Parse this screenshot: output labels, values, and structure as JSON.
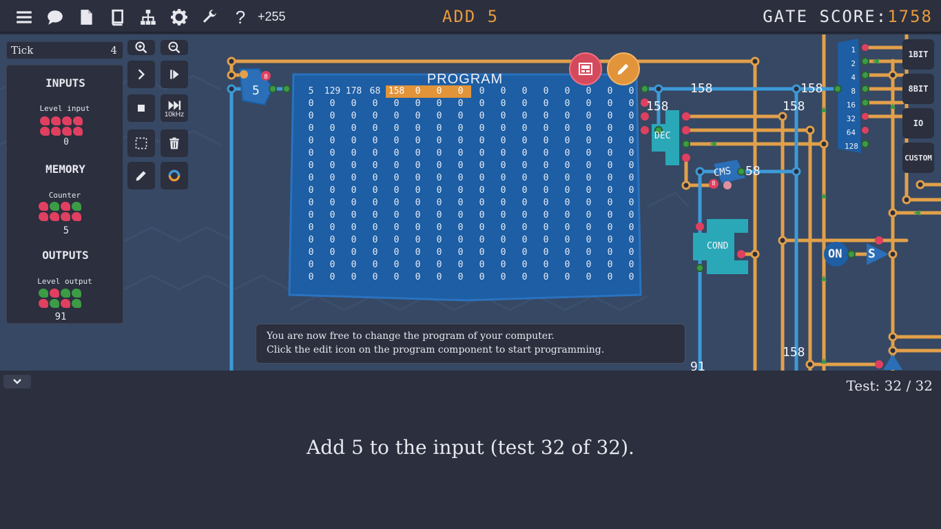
{
  "topbar": {
    "icons": [
      "menu-icon",
      "chat-icon",
      "document-icon",
      "book-icon",
      "hierarchy-icon",
      "settings-icon",
      "wrench-icon",
      "help-icon"
    ],
    "help_glyph": "?",
    "points": "+255",
    "level_title": "ADD 5",
    "gate_score_label": "GATE SCORE:",
    "gate_score_value": "1758"
  },
  "sidebar": {
    "tick_label": "Tick",
    "tick_value": "4",
    "inputs_title": "INPUTS",
    "level_input_label": "Level input",
    "level_input_bits": [
      "r",
      "r",
      "r",
      "r",
      "r",
      "r",
      "r",
      "r"
    ],
    "level_input_value": "0",
    "memory_title": "MEMORY",
    "counter_label": "Counter",
    "counter_bits": [
      "r",
      "g",
      "r",
      "g",
      "r",
      "r",
      "r",
      "r"
    ],
    "counter_value": "5",
    "outputs_title": "OUTPUTS",
    "level_output_label": "Level output",
    "level_output_bits": [
      "g",
      "r",
      "g",
      "g",
      "r",
      "g",
      "r",
      "g"
    ],
    "level_output_value": "91"
  },
  "tools": {
    "zoom_in": "zoom-in-icon",
    "zoom_out": "zoom-out-icon",
    "step": "step-icon",
    "play": "play-icon",
    "stop": "stop-icon",
    "fast_label": "10kHz",
    "select": "select-icon",
    "delete": "trash-icon",
    "pencil": "pencil-icon",
    "color": "color-wheel-icon"
  },
  "palette": [
    "1BIT",
    "8BIT",
    "IO",
    "CUSTOM"
  ],
  "program": {
    "title": "PROGRAM",
    "first_row": [
      "5",
      "129",
      "178",
      "68",
      "158",
      "0",
      "0",
      "0",
      "0",
      "0",
      "0",
      "0",
      "0",
      "0",
      "0",
      "0"
    ],
    "highlight_cols": [
      4,
      5,
      6,
      7
    ],
    "zero_rows": 15
  },
  "circuit": {
    "input_value": "5",
    "input_badge": "8",
    "dec_label": "DEC",
    "cms_label": "CMS",
    "cms_badge": "8",
    "cond_label": "COND",
    "on_label": "ON",
    "s_label": "S",
    "wire_labels": [
      "158",
      "158",
      "158",
      "158",
      "58",
      "158",
      "91"
    ],
    "splitter_labels": [
      "1",
      "2",
      "4",
      "8",
      "16",
      "32",
      "64",
      "128"
    ]
  },
  "hint": {
    "line1": "You are now free to change the program of your computer.",
    "line2": "Click the edit icon on the program component to start programming."
  },
  "bottom": {
    "test_count": "Test: 32 / 32",
    "description": "Add 5 to the input (test 32 of 32)."
  },
  "colors": {
    "accent": "#e89b3a",
    "wire_orange": "#e2a04a",
    "wire_blue": "#3d9ad8",
    "component_blue": "#1d5ea4",
    "cyan": "#2aa8b8",
    "red_bit": "#e04060",
    "green_bit": "#3c9c46"
  }
}
